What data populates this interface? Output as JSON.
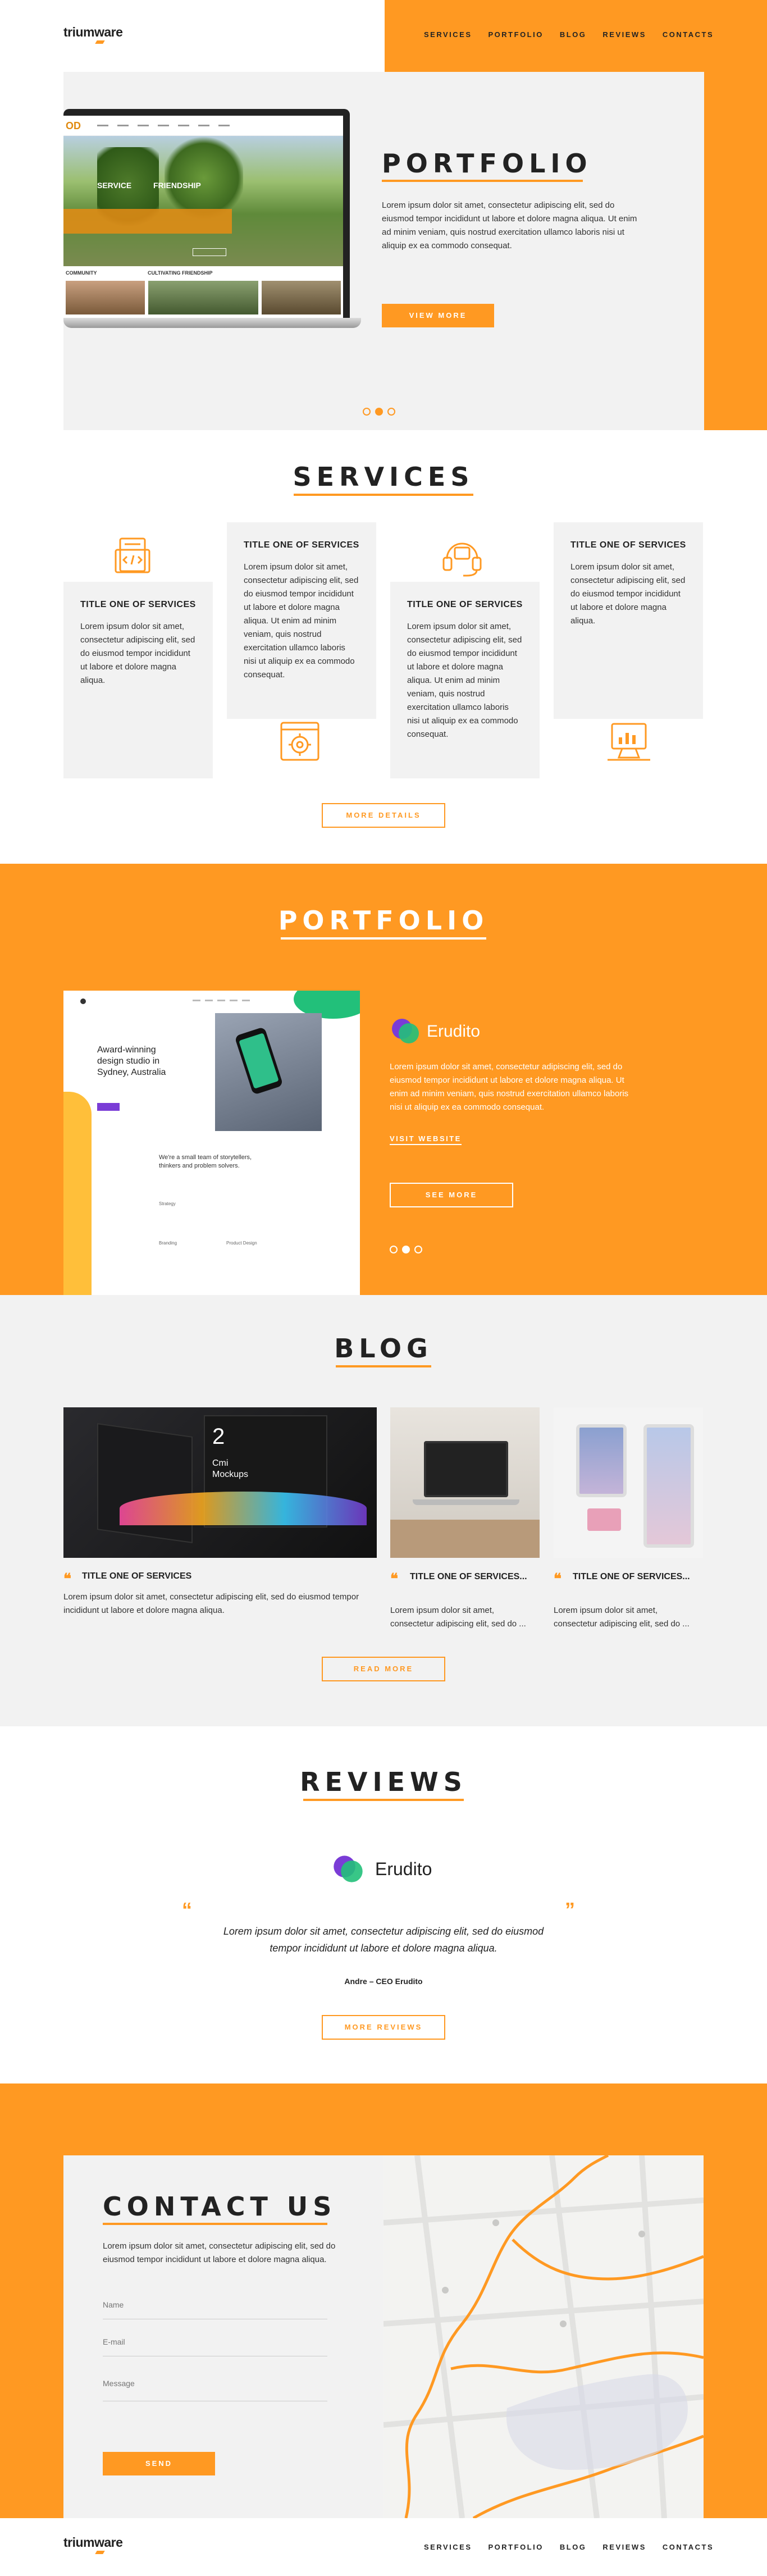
{
  "brand": {
    "logo": "triumware",
    "accent": "#ff9922"
  },
  "nav": {
    "items": [
      "SERVICES",
      "PORTFOLIO",
      "BLOG",
      "REVIEWS",
      "CONTACTS"
    ]
  },
  "hero": {
    "title": "PORTFOLIO",
    "text": "Lorem ipsum dolor sit amet, consectetur adipiscing elit, sed do eiusmod tempor incididunt ut labore et dolore magna aliqua. Ut enim ad minim veniam, quis nostrud exercitation ullamco laboris nisi ut aliquip ex ea commodo consequat.",
    "button": "VIEW MORE",
    "laptop": {
      "tab1": "SERVICE",
      "tab2": "FRIENDSHIP",
      "label1": "COMMUNITY",
      "label2": "CULTIVATING FRIENDSHIP"
    }
  },
  "services": {
    "title": "SERVICES",
    "cards": [
      {
        "title": "TITLE ONE OF SERVICES",
        "text": "Lorem ipsum dolor sit amet, consectetur adipiscing elit, sed do eiusmod tempor incididunt ut labore et dolore magna aliqua.",
        "icon": "code-document-icon"
      },
      {
        "title": "TITLE ONE OF SERVICES",
        "text": "Lorem ipsum dolor sit amet, consectetur adipiscing elit, sed do eiusmod tempor incididunt ut labore et dolore magna aliqua. Ut enim ad minim veniam, quis nostrud exercitation ullamco laboris nisi ut aliquip ex ea commodo consequat.",
        "icon": "settings-code-icon"
      },
      {
        "title": "TITLE ONE OF SERVICES",
        "text": "Lorem ipsum dolor sit amet, consectetur adipiscing elit, sed do eiusmod tempor incididunt ut labore et dolore magna aliqua. Ut enim ad minim veniam, quis nostrud exercitation ullamco laboris nisi ut aliquip ex ea commodo consequat.",
        "icon": "headset-support-icon"
      },
      {
        "title": "TITLE ONE OF SERVICES",
        "text": "Lorem ipsum dolor sit amet, consectetur adipiscing elit, sed do eiusmod tempor incididunt ut labore et dolore magna aliqua.",
        "icon": "analytics-monitor-icon"
      }
    ],
    "button": "MORE DETAILS"
  },
  "portfolio": {
    "title": "PORTFOLIO",
    "client": "Erudito",
    "text": "Lorem ipsum dolor sit amet, consectetur adipiscing elit, sed do eiusmod tempor incididunt ut labore et dolore magna aliqua. Ut enim ad minim veniam, quis nostrud exercitation ullamco laboris nisi ut aliquip ex ea commodo consequat.",
    "link": "VISIT WEBSITE",
    "button": "SEE MORE",
    "mock": {
      "headline": "Award-winning design studio in Sydney, Australia",
      "team": "We're a small team of storytellers, thinkers and problem solvers.",
      "strategy": "Strategy",
      "branding": "Branding",
      "product": "Product Design"
    }
  },
  "blog": {
    "title": "BLOG",
    "posts": [
      {
        "title": "TITLE ONE OF SERVICES",
        "text": "Lorem ipsum dolor sit amet, consectetur adipiscing elit, sed do eiusmod tempor incididunt ut labore et dolore magna aliqua."
      },
      {
        "title": "TITLE ONE OF SERVICES...",
        "text": "Lorem ipsum dolor sit amet, consectetur adipiscing elit, sed do ..."
      },
      {
        "title": "TITLE ONE OF SERVICES...",
        "text": "Lorem ipsum dolor sit amet, consectetur adipiscing elit, sed do ..."
      }
    ],
    "screen_num": "2",
    "screen_text": "Cmi Mockups",
    "button": "READ MORE"
  },
  "reviews": {
    "title": "REVIEWS",
    "client": "Erudito",
    "quote": "Lorem ipsum dolor sit amet, consectetur adipiscing elit, sed do eiusmod tempor incididunt ut labore et dolore magna aliqua.",
    "author": "Andre – CEO Erudito",
    "button": "MORE REVIEWS"
  },
  "contact": {
    "title": "CONTACT US",
    "text": "Lorem ipsum dolor sit amet, consectetur adipiscing elit, sed do eiusmod tempor incididunt ut labore et dolore magna aliqua.",
    "name_placeholder": "Name",
    "email_placeholder": "E-mail",
    "message_placeholder": "Message",
    "button": "SEND"
  },
  "footer": {
    "logo": "triumware",
    "nav": [
      "SERVICES",
      "PORTFOLIO",
      "BLOG",
      "REVIEWS",
      "CONTACTS"
    ]
  }
}
